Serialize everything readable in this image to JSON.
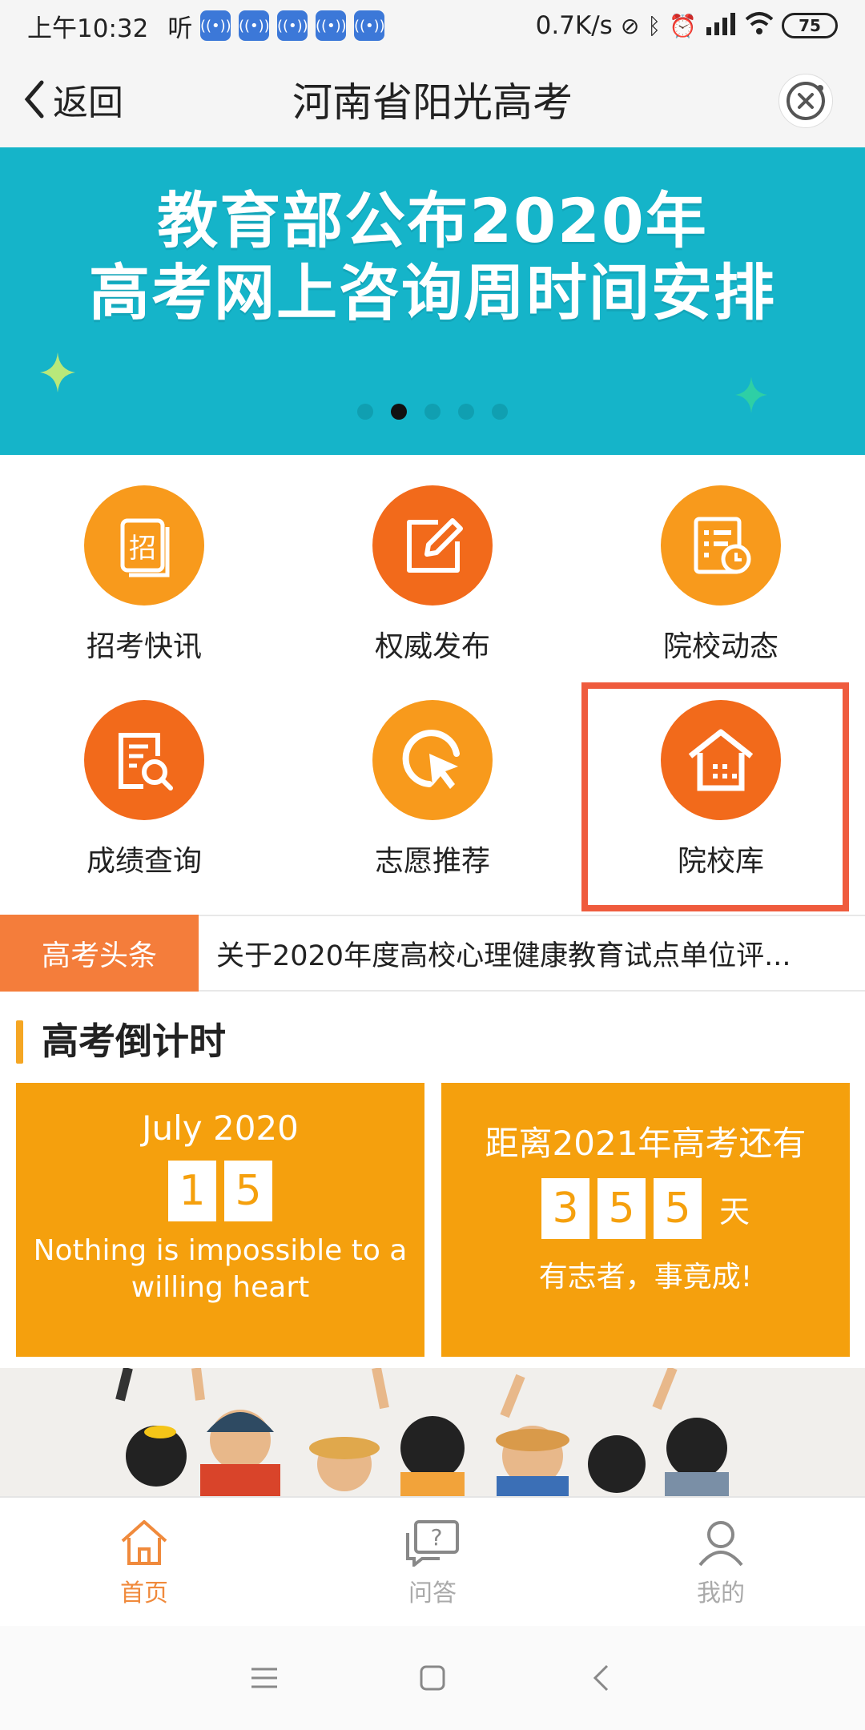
{
  "status_bar": {
    "time": "上午10:32",
    "listen": "听",
    "network_speed": "0.7K/s",
    "battery": "75"
  },
  "nav": {
    "back_label": "返回",
    "title": "河南省阳光高考"
  },
  "banner": {
    "line1": "教育部公布2020年",
    "line2": "高考网上咨询周时间安排",
    "page_count": 5,
    "active_index": 1
  },
  "grid": {
    "items": [
      {
        "label": "招考快讯",
        "icon": "zhao-icon",
        "color": "#f89a1c"
      },
      {
        "label": "权威发布",
        "icon": "edit-icon",
        "color": "#f26a1b"
      },
      {
        "label": "院校动态",
        "icon": "calendar-clock-icon",
        "color": "#f89a1c"
      },
      {
        "label": "成绩查询",
        "icon": "search-doc-icon",
        "color": "#f26a1b"
      },
      {
        "label": "志愿推荐",
        "icon": "cursor-icon",
        "color": "#f89a1c"
      },
      {
        "label": "院校库",
        "icon": "building-icon",
        "color": "#f26a1b"
      }
    ],
    "highlight_color": "#ef5b3d"
  },
  "headline": {
    "tag": "高考头条",
    "text": "关于2020年度高校心理健康教育试点单位评..."
  },
  "countdown": {
    "title": "高考倒计时",
    "left": {
      "month": "July 2020",
      "digits": [
        "1",
        "5"
      ],
      "motto": "Nothing is impossible to a willing heart"
    },
    "right": {
      "head": "距离2021年高考还有",
      "digits": [
        "3",
        "5",
        "5"
      ],
      "unit": "天",
      "slogan": "有志者，事竟成!"
    }
  },
  "tabs": [
    {
      "label": "首页",
      "icon": "home-icon",
      "active": true
    },
    {
      "label": "问答",
      "icon": "qa-icon",
      "active": false
    },
    {
      "label": "我的",
      "icon": "user-icon",
      "active": false
    }
  ],
  "colors": {
    "accent": "#f08a3c",
    "banner_bg": "#15b4c9",
    "countdown_bg": "#f5a00d"
  }
}
